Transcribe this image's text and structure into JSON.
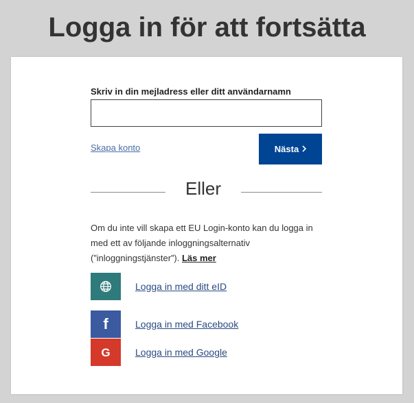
{
  "header": {
    "title": "Logga in för att fortsätta"
  },
  "login_form": {
    "field_label": "Skriv in din mejladress eller ditt användarnamn",
    "input_value": "",
    "input_placeholder": "",
    "create_account_link": "Skapa konto",
    "next_button_label": "Nästa",
    "next_button_icon": "chevron-right-icon",
    "divider_text": "Eller"
  },
  "alternatives": {
    "info_text": "Om du inte vill skapa ett EU Login-konto kan du logga in med ett av följande inloggningsalternativ (”inloggningstjänster”).",
    "read_more_link": "Läs mer",
    "providers": [
      {
        "label": "Logga in med ditt eID",
        "icon": "globe-icon",
        "color": "#2f7a7a"
      },
      {
        "label": "Logga in med Facebook",
        "icon": "facebook-icon",
        "color": "#3b5aa0"
      },
      {
        "label": "Logga in med Google",
        "icon": "google-icon",
        "color": "#d5392a"
      }
    ]
  },
  "colors": {
    "primary": "#004494",
    "background": "#d3d3d3",
    "card": "#ffffff"
  }
}
